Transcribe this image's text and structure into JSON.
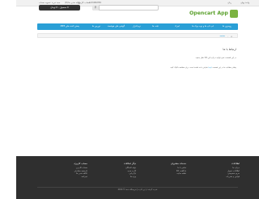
{
  "topbar": {
    "right_1": "واحد پولی",
    "right_2": "زبان",
    "phone_icon": "phone-icon",
    "phone": "123456789",
    "account": "حساب کاربری",
    "wishlist": "علاقه مندی ها (0)",
    "cart_link": "سبد خرید",
    "checkout": "تسویه حساب"
  },
  "header": {
    "logo_text": "Opencart App",
    "search_placeholder": "",
    "search_icon": "search-icon",
    "cart_button": "0 محصول - 0 تومان"
  },
  "nav": {
    "items": [
      "رومیزی ها",
      "لپ تاپ ها و نوت بوک ها",
      "اجزاء",
      "تبلت ها",
      "نرم افزار",
      "گوشی های هوشمند",
      "دوربین ها",
      "پخش کننده های MP3"
    ]
  },
  "breadcrumb": {
    "home_icon": "home-icon",
    "separator": "›",
    "current": "صفحه"
  },
  "content": {
    "title": "ارتباط با ما",
    "paragraph_1": "در این قسمت نمی توانید درباره این کالا نظر بدهید.",
    "paragraph_2_before": "بیشتر مطالب ما در این قسمت",
    "paragraph_2_link": "اینجا",
    "paragraph_2_after": "نمایش داده نشده است. برای مشاهده کلیک کنید."
  },
  "footer": {
    "columns": [
      {
        "heading": "اطلاعات",
        "links": [
          "درباره ما",
          "اطلاعات تحویل",
          "حریم خصوصی",
          "قوانین و مقررات"
        ]
      },
      {
        "heading": "خدمات مشتریان",
        "links": [
          "تماس با ما",
          "بازگشت کالا",
          "نقشه سایت"
        ]
      },
      {
        "heading": "دیگر امکانات",
        "links": [
          "تولید کنندگان",
          "کارت هدیه",
          "بازاریابی",
          "ویژه ها"
        ]
      },
      {
        "heading": "حساب کاربری",
        "links": [
          "حساب کاربری",
          "تاریخچه سفارش",
          "علاقه مندی ها",
          "خبرنامه"
        ]
      }
    ],
    "copyright": "قدرت گرفته از اپن کارت | فروشگاه شما © 2014"
  }
}
